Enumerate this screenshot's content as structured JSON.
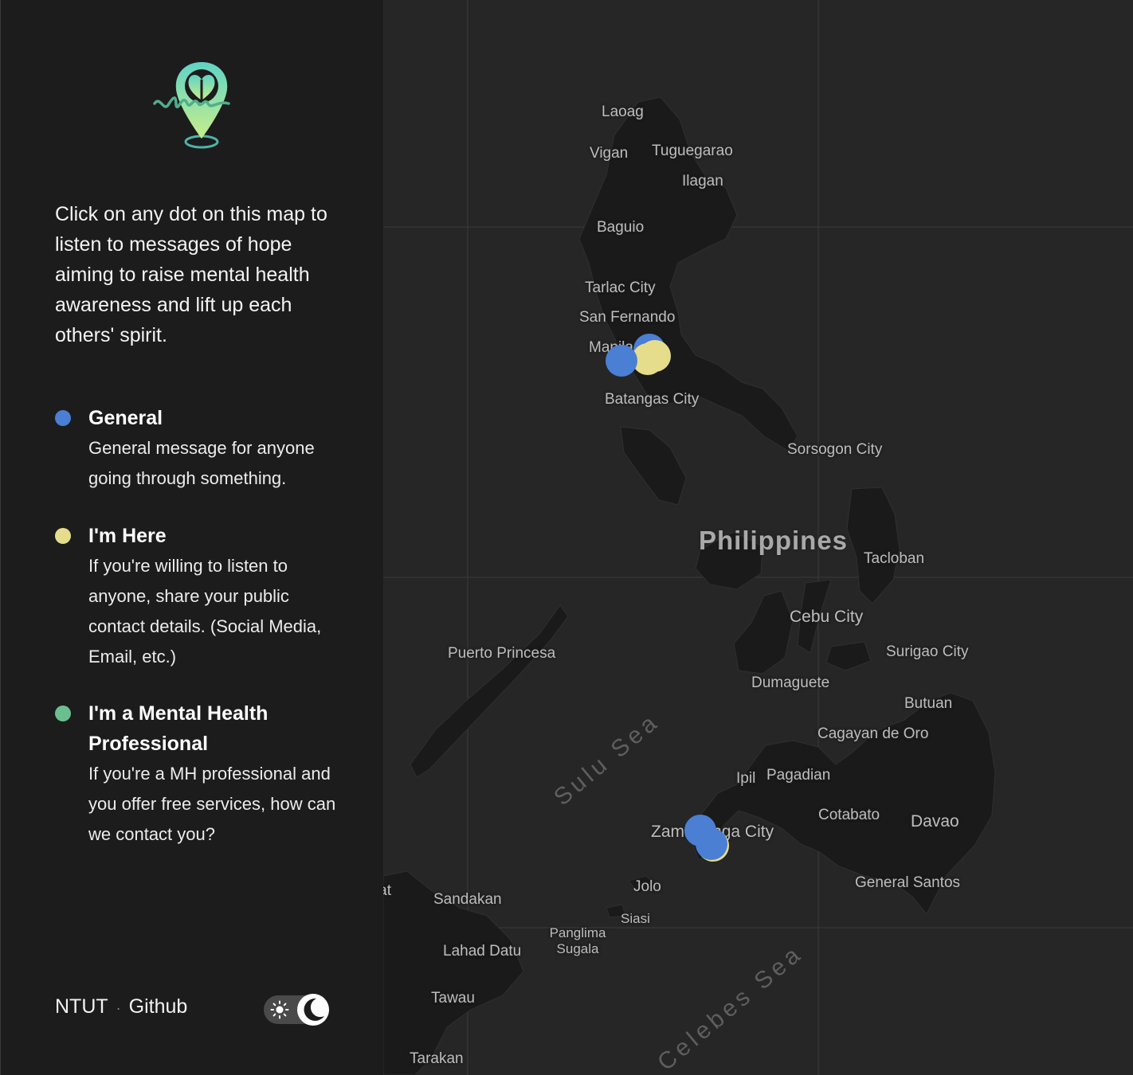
{
  "intro": "Click on any dot on this map to listen to messages of hope aiming to raise mental health awareness and lift up each others' spirit.",
  "legend": [
    {
      "title": "General",
      "description": "General message for anyone going through something.",
      "color": "#4a7fd4"
    },
    {
      "title": "I'm Here",
      "description": "If you're willing to listen to anyone, share your public contact details. (Social Media, Email, etc.)",
      "color": "#e6dd8c"
    },
    {
      "title": "I'm a Mental Health Professional",
      "description": "If you're a MH professional and you offer free services, how can we contact you?",
      "color": "#6bbf8e"
    }
  ],
  "footer": {
    "link1": "NTUT",
    "separator": "·",
    "link2": "Github"
  },
  "theme_toggle": {
    "mode": "dark"
  },
  "map": {
    "country_label": "Philippines",
    "seas": [
      "Sulu Sea",
      "Celebes Sea"
    ],
    "cities": [
      "Laoag",
      "Vigan",
      "Tuguegarao",
      "Ilagan",
      "Baguio",
      "Tarlac City",
      "San Fernando",
      "Manila",
      "Batangas City",
      "Sorsogon City",
      "Tacloban",
      "Cebu City",
      "Surigao City",
      "Puerto Princesa",
      "Dumaguete",
      "Butuan",
      "Cagayan de Oro",
      "Ipil",
      "Pagadian",
      "Cotabato",
      "Davao",
      "Zamboanga City",
      "Jolo",
      "Siasi",
      "Sandakan",
      "Lahad Datu",
      "Panglima Sugala",
      "Tawau",
      "Tarakan",
      "General Santos",
      "Kudat"
    ],
    "markers": [
      {
        "category": "General",
        "near": "Manila"
      },
      {
        "category": "I'm Here",
        "near": "Manila"
      },
      {
        "category": "General",
        "near": "Manila"
      },
      {
        "category": "General",
        "near": "Zamboanga City"
      },
      {
        "category": "I'm Here",
        "near": "Zamboanga City"
      },
      {
        "category": "General",
        "near": "Zamboanga City"
      }
    ]
  }
}
